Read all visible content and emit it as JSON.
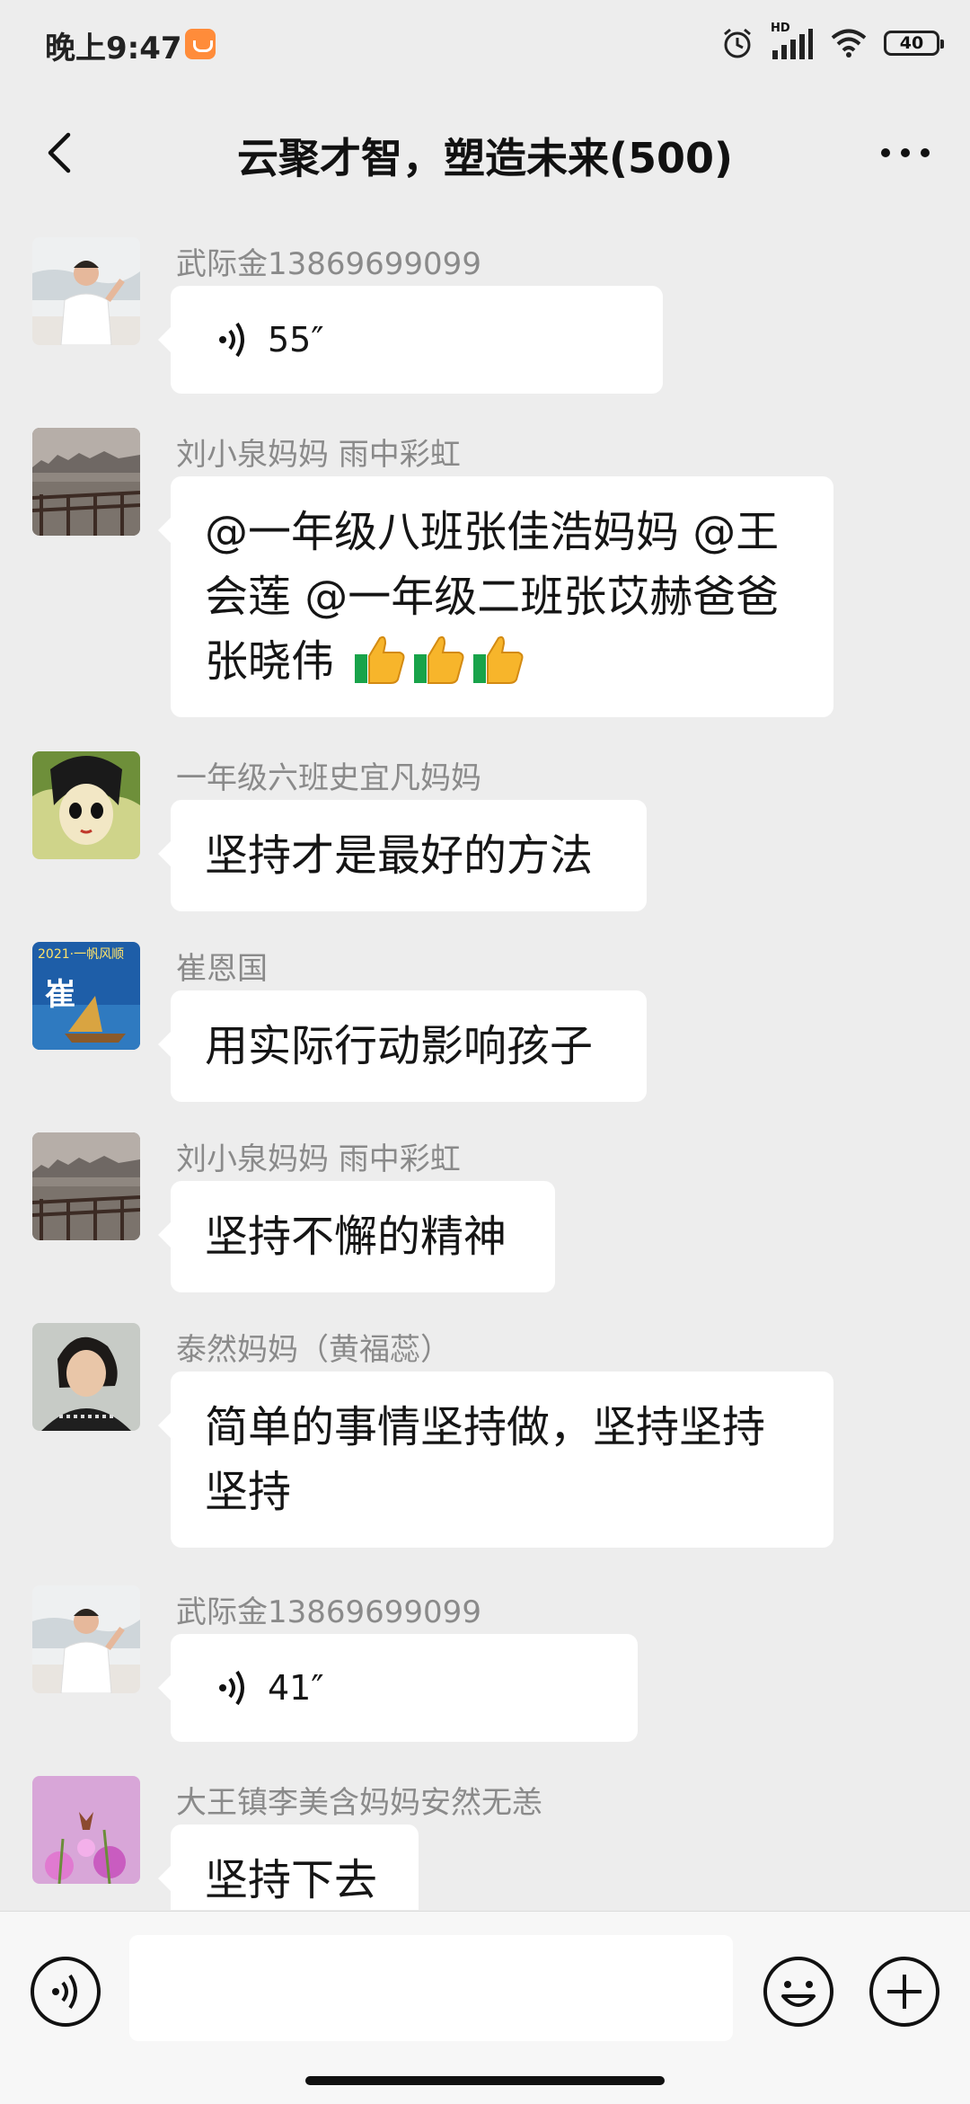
{
  "status_bar": {
    "time": "晚上9:47",
    "hd_label": "HD",
    "battery": "40"
  },
  "header": {
    "title": "云聚才智，塑造未来(500)"
  },
  "messages": [
    {
      "sender": "武际金13869699099",
      "type": "voice",
      "duration": "55″"
    },
    {
      "sender": "刘小泉妈妈  雨中彩虹",
      "type": "text",
      "text": "@一年级八班张佳浩妈妈 @王会莲 @一年级二班张苡赫爸爸张晓伟",
      "emoji": [
        "thumbs-up",
        "thumbs-up",
        "thumbs-up"
      ]
    },
    {
      "sender": "一年级六班史宜凡妈妈",
      "type": "text",
      "text": "坚持才是最好的方法"
    },
    {
      "sender": "崔恩国",
      "type": "text",
      "text": "用实际行动影响孩子",
      "avatar_text": "2021·一帆风顺",
      "avatar_char": "崔"
    },
    {
      "sender": "刘小泉妈妈  雨中彩虹",
      "type": "text",
      "text": "坚持不懈的精神"
    },
    {
      "sender": "泰然妈妈（黄福蕊）",
      "type": "text",
      "text": "简单的事情坚持做，坚持坚持坚持"
    },
    {
      "sender": "武际金13869699099",
      "type": "voice",
      "duration": "41″"
    },
    {
      "sender": "大王镇李美含妈妈安然无恙",
      "type": "text",
      "text": "坚持下去"
    }
  ],
  "input_bar": {
    "placeholder": ""
  },
  "colors": {
    "background": "#ededed",
    "bubble": "#ffffff",
    "sender": "#8a8a8a"
  }
}
